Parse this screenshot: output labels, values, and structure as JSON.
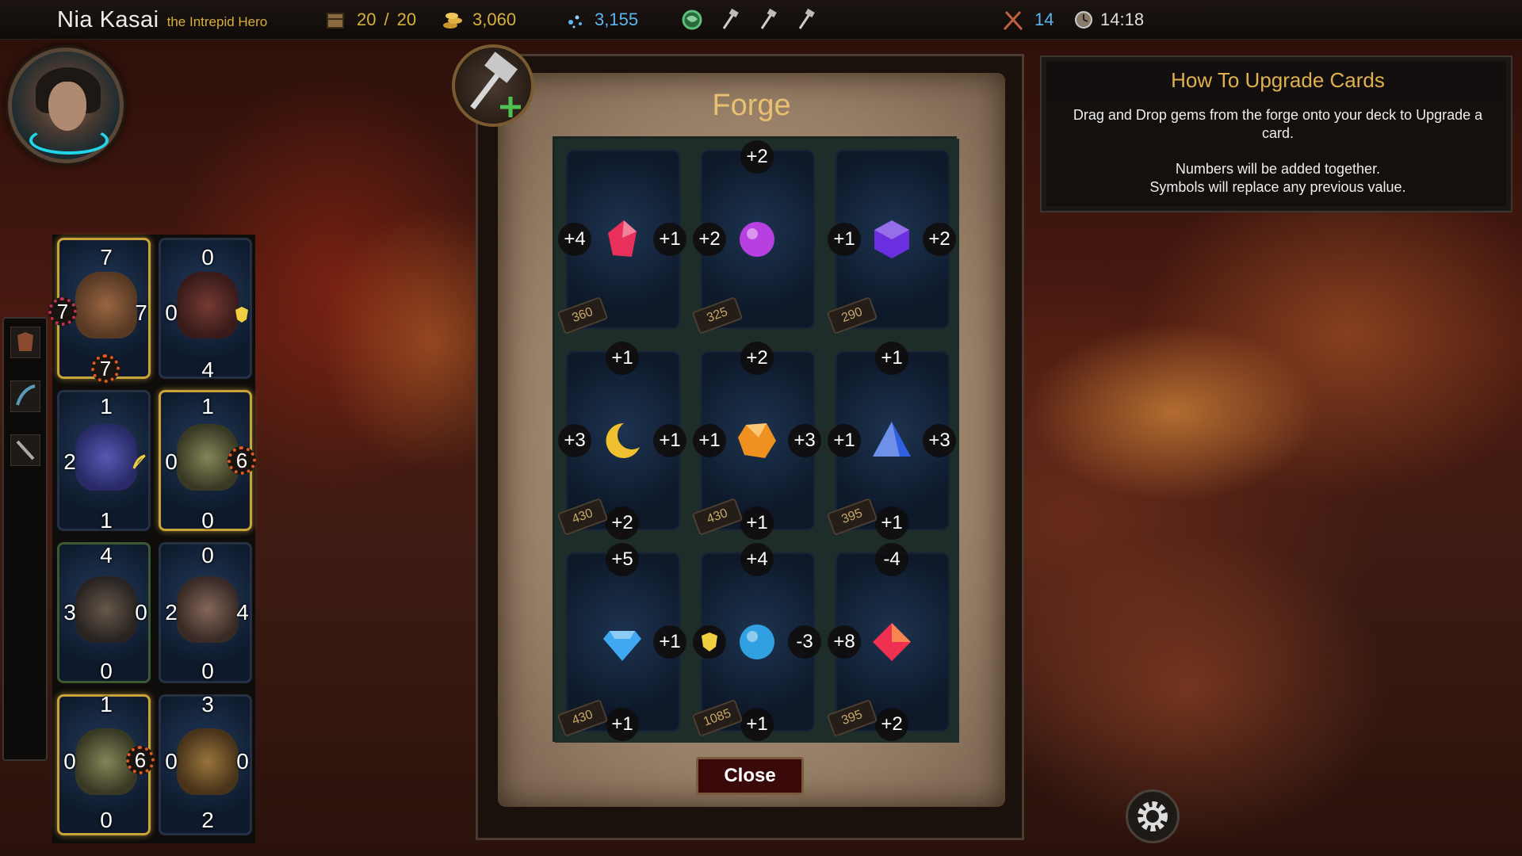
{
  "topbar": {
    "hero_name": "Nia Kasai",
    "hero_title": "the Intrepid Hero",
    "deck_count": "20",
    "deck_sep": "/",
    "deck_max": "20",
    "gold": "3,060",
    "dust": "3,155",
    "tokens": "14",
    "time": "14:18"
  },
  "icons": {
    "deck": "crate-icon",
    "gold": "gold-coins-icon",
    "dust": "sparkle-dust-icon",
    "map": "globe-icon",
    "tool": "hammer-token-icon",
    "tokens": "crossed-axes-icon",
    "clock": "clock-icon",
    "settings": "gear-icon"
  },
  "deck": [
    {
      "top": "7",
      "left": "7",
      "right": "7",
      "bottom": "7",
      "creature": "bear"
    },
    {
      "top": "0",
      "left": "0",
      "right": "",
      "bottom": "4",
      "creature": "golem"
    },
    {
      "top": "1",
      "left": "2",
      "right": "",
      "bottom": "1",
      "creature": "beast"
    },
    {
      "top": "1",
      "left": "0",
      "right": "6",
      "bottom": "0",
      "creature": "toad"
    },
    {
      "top": "4",
      "left": "3",
      "right": "0",
      "bottom": "0",
      "creature": "rat"
    },
    {
      "top": "0",
      "left": "2",
      "right": "4",
      "bottom": "0",
      "creature": "kobold"
    },
    {
      "top": "1",
      "left": "0",
      "right": "6",
      "bottom": "0",
      "creature": "toad"
    },
    {
      "top": "3",
      "left": "0",
      "right": "0",
      "bottom": "2",
      "creature": "hyena"
    }
  ],
  "forge": {
    "title": "Forge",
    "close_label": "Close",
    "gems": [
      {
        "top": "",
        "left": "+4",
        "right": "+1",
        "bottom": "",
        "price": "360",
        "gem": "ruby-shard",
        "color": "#e8305a"
      },
      {
        "top": "+2",
        "left": "+2",
        "right": "",
        "bottom": "",
        "price": "325",
        "gem": "orb",
        "color": "#b840e0"
      },
      {
        "top": "",
        "left": "+1",
        "right": "+2",
        "bottom": "",
        "price": "290",
        "gem": "amethyst",
        "color": "#6a30e0"
      },
      {
        "top": "+1",
        "left": "+3",
        "right": "+1",
        "bottom": "+2",
        "price": "430",
        "gem": "moon",
        "color": "#f0c030"
      },
      {
        "top": "+2",
        "left": "+1",
        "right": "+3",
        "bottom": "+1",
        "price": "430",
        "gem": "amber",
        "color": "#f09020"
      },
      {
        "top": "+1",
        "left": "+1",
        "right": "+3",
        "bottom": "+1",
        "price": "395",
        "gem": "sapphire-pyramid",
        "color": "#3060e0"
      },
      {
        "top": "+5",
        "left": "",
        "right": "+1",
        "bottom": "+1",
        "price": "430",
        "gem": "diamond",
        "color": "#40a8f0"
      },
      {
        "top": "+4",
        "left": "shield",
        "right": "-3",
        "bottom": "+1",
        "price": "1085",
        "gem": "swirl-orb",
        "color": "#30a0e0"
      },
      {
        "top": "-4",
        "left": "+8",
        "right": "",
        "bottom": "+2",
        "price": "395",
        "gem": "heart-gem",
        "color": "#f03050"
      }
    ]
  },
  "info": {
    "title": "How To Upgrade Cards",
    "line1": "Drag and Drop gems from the forge onto your deck to Upgrade a card.",
    "line2": "Numbers will be added together.",
    "line3": "Symbols will replace any previous value."
  }
}
